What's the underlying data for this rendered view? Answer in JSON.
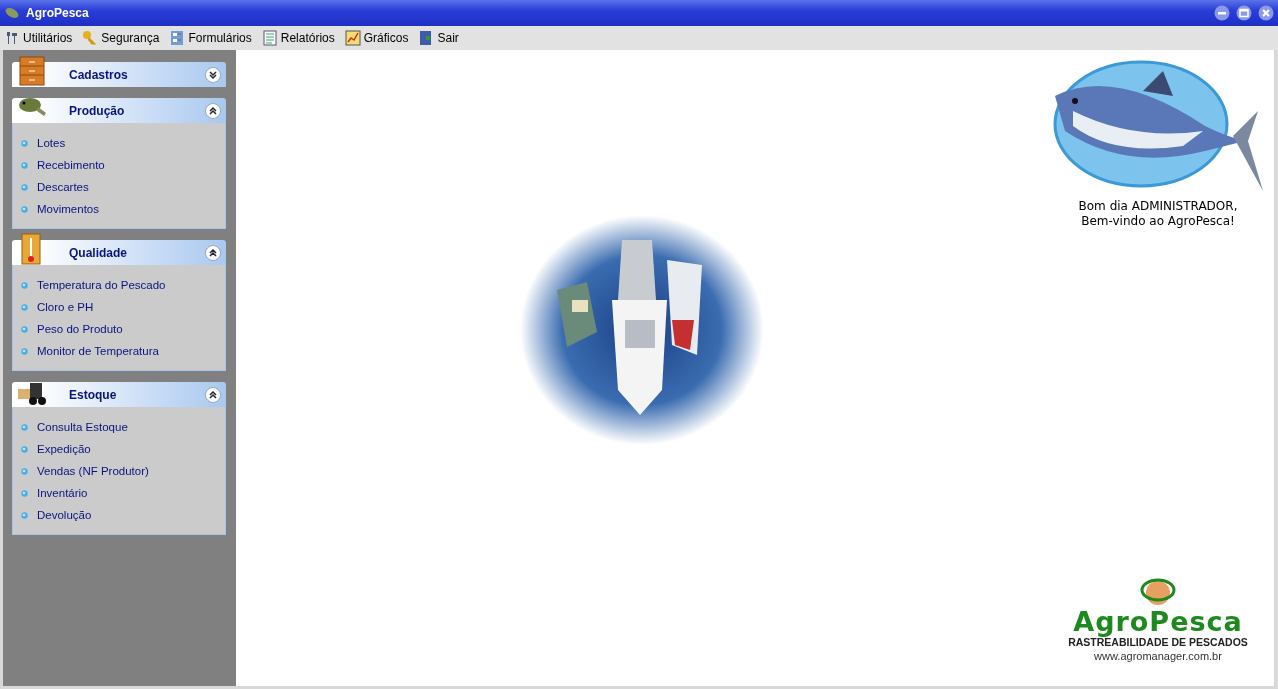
{
  "window": {
    "title": "AgroPesca"
  },
  "menu": [
    {
      "label": "Utilitários"
    },
    {
      "label": "Segurança"
    },
    {
      "label": "Formulários"
    },
    {
      "label": "Relatórios"
    },
    {
      "label": "Gráficos"
    },
    {
      "label": "Sair"
    }
  ],
  "sidebar": {
    "sections": [
      {
        "title": "Cadastros",
        "expanded": false
      },
      {
        "title": "Produção",
        "expanded": true,
        "items": [
          "Lotes",
          "Recebimento",
          "Descartes",
          "Movimentos"
        ]
      },
      {
        "title": "Qualidade",
        "expanded": true,
        "items": [
          "Temperatura do Pescado",
          "Cloro e PH",
          "Peso do Produto",
          "Monitor de Temperatura"
        ]
      },
      {
        "title": "Estoque",
        "expanded": true,
        "items": [
          "Consulta Estoque",
          "Expedição",
          "Vendas (NF Produtor)",
          "Inventário",
          "Devolução"
        ]
      }
    ]
  },
  "welcome": {
    "lines": [
      "Bom dia ADMINISTRADOR,",
      "Bem-vindo ao AgroPesca!"
    ]
  },
  "brand": {
    "name": "AgroPesca",
    "tagline": "RASTREABILIDADE DE PESCADOS",
    "url": "www.agromanager.com.br"
  }
}
